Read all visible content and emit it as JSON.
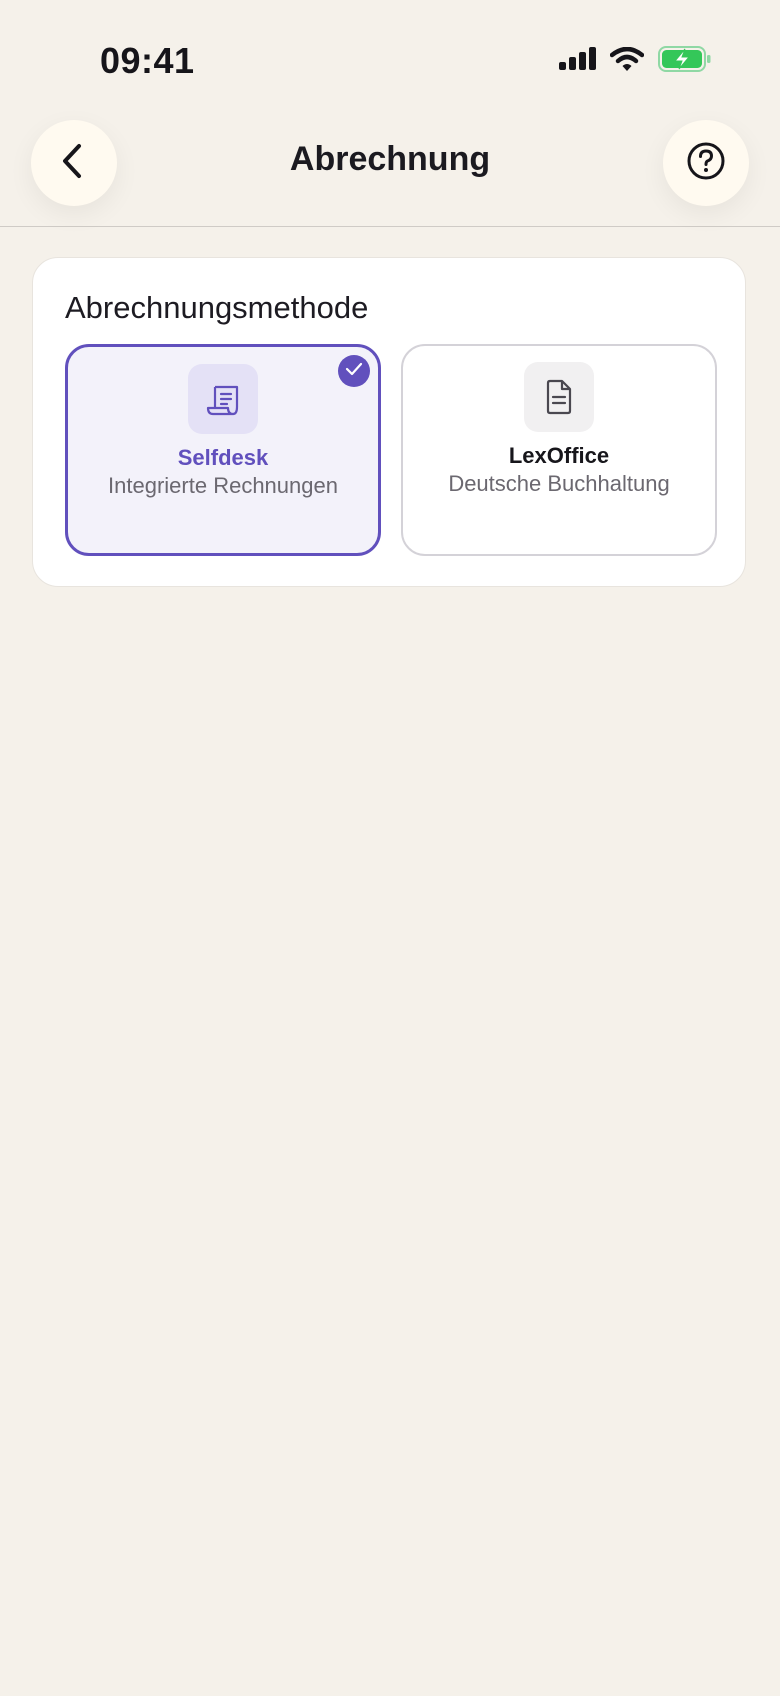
{
  "status_bar": {
    "time": "09:41",
    "signal_icon": "cellular-signal-icon",
    "wifi_icon": "wifi-icon",
    "battery_icon": "battery-charging-icon"
  },
  "header": {
    "title": "Abrechnung",
    "back_icon": "chevron-left-icon",
    "help_icon": "question-circle-icon"
  },
  "billing": {
    "section_title": "Abrechnungsmethode",
    "options": [
      {
        "name": "Selfdesk",
        "description": "Integrierte Rechnungen",
        "icon": "receipt-icon",
        "selected": true
      },
      {
        "name": "LexOffice",
        "description": "Deutsche Buchhaltung",
        "icon": "document-icon",
        "selected": false
      }
    ]
  },
  "colors": {
    "background": "#f5f1ea",
    "accent": "#6150bd",
    "battery": "#34c759"
  }
}
